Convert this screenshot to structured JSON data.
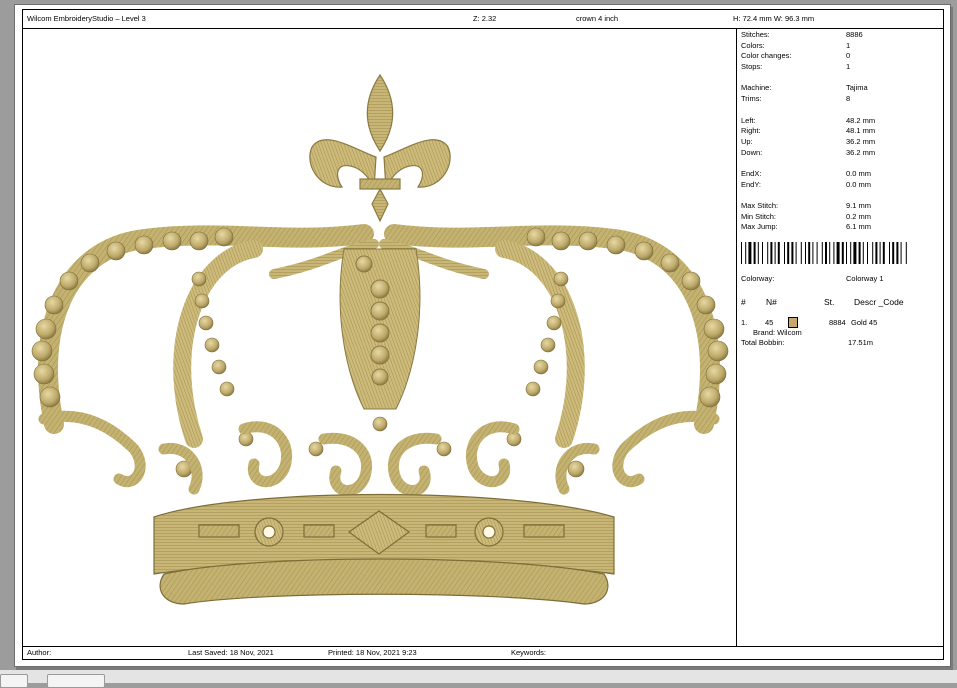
{
  "header": {
    "app_title": "Wilcom EmbroideryStudio – Level 3",
    "zoom": "Z: 2.32",
    "design_name": "crown  4 inch",
    "dimensions": "H: 72.4 mm   W: 96.3 mm"
  },
  "stats": {
    "stitches_label": "Stitches:",
    "stitches": "8886",
    "colors_label": "Colors:",
    "colors": "1",
    "color_changes_label": "Color changes:",
    "color_changes": "0",
    "stops_label": "Stops:",
    "stops": "1",
    "machine_label": "Machine:",
    "machine": "Tajima",
    "trims_label": "Trims:",
    "trims": "8",
    "left_label": "Left:",
    "left": "48.2 mm",
    "right_label": "Right:",
    "right": "48.1 mm",
    "up_label": "Up:",
    "up": "36.2 mm",
    "down_label": "Down:",
    "down": "36.2 mm",
    "endx_label": "EndX:",
    "endx": "0.0 mm",
    "endy_label": "EndY:",
    "endy": "0.0 mm",
    "max_stitch_label": "Max Stitch:",
    "max_stitch": "9.1 mm",
    "min_stitch_label": "Min Stitch:",
    "min_stitch": "0.2 mm",
    "max_jump_label": "Max Jump:",
    "max_jump": "6.1 mm"
  },
  "colorway": {
    "label": "Colorway:",
    "value": "Colorway 1",
    "col_num": "#",
    "col_needle": "N#",
    "col_st": "St.",
    "col_descr": "Descr _Code",
    "entry": {
      "num": "1.",
      "needle": "45",
      "stitches": "8884",
      "descr": "Gold 45",
      "brand": "Brand: Wilcom",
      "swatch_color": "#c8a96a"
    },
    "total_bobbin_label": "Total Bobbin:",
    "total_bobbin": "17.51m"
  },
  "footer": {
    "author": "Author:",
    "last_saved": "Last Saved: 18 Nov, 2021",
    "printed": "Printed: 18 Nov, 2021  9:23",
    "keywords": "Keywords:"
  },
  "colors": {
    "thread_gold": "#c2b06e",
    "thread_shadow": "#8a7a42",
    "thread_highlight": "#e2d59c"
  }
}
